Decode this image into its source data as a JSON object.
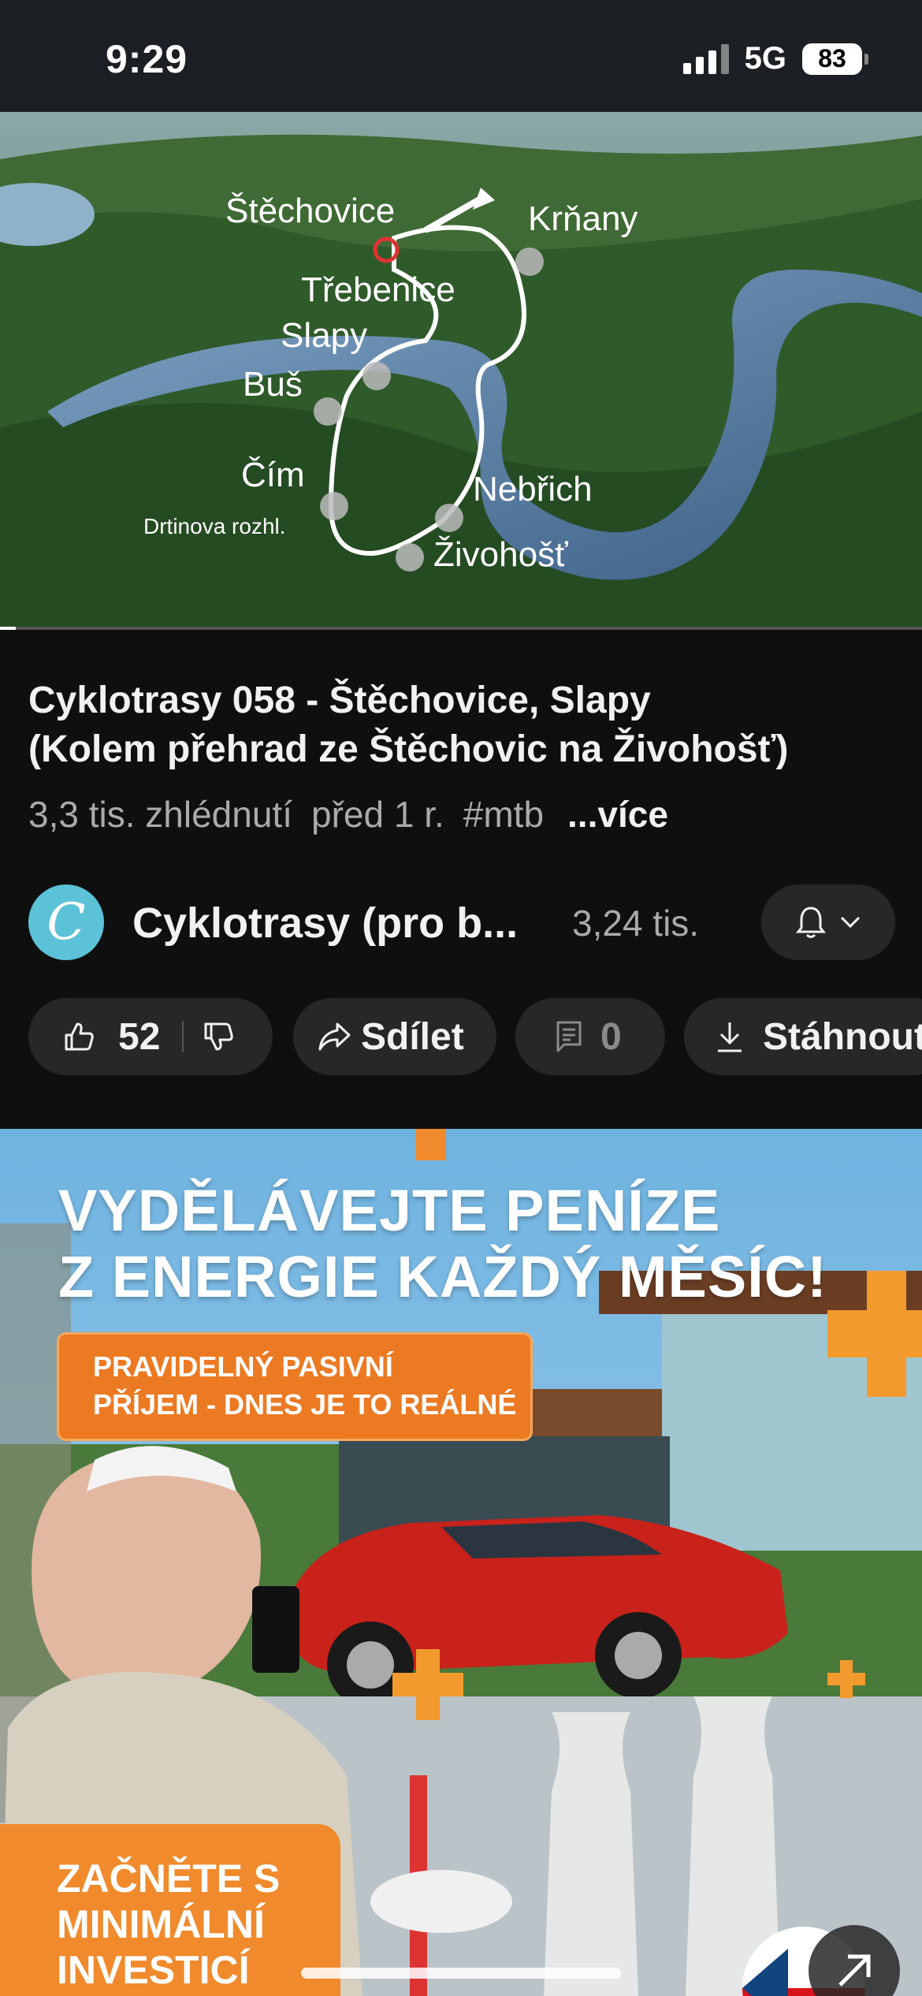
{
  "status_bar": {
    "time": "9:29",
    "network": "5G",
    "battery": "83"
  },
  "video": {
    "map_labels": [
      "Štěchovice",
      "Krňany",
      "Třebenice",
      "Slapy",
      "Buš",
      "Čím",
      "Drtinova rozhl.",
      "Nebřich",
      "Živohošť"
    ]
  },
  "info": {
    "title_line1": "Cyklotrasy 058 - Štěchovice, Slapy",
    "title_line2": "(Kolem přehrad ze Štěchovic na Živohošť)",
    "views": "3,3 tis. zhlédnutí",
    "age": "před 1 r.",
    "hashtag": "#mtb",
    "more": "...více"
  },
  "channel": {
    "avatar_letter": "C",
    "name": "Cyklotrasy (pro b...",
    "subscribers": "3,24 tis."
  },
  "actions": {
    "likes": "52",
    "share": "Sdílet",
    "comments": "0",
    "download": "Stáhnout"
  },
  "ad": {
    "headline_line1": "VYDĚLÁVEJTE PENÍZE",
    "headline_line2": "Z ENERGIE KAŽDÝ MĚSÍC!",
    "box_line1": "PRAVIDELNÝ PASIVNÍ",
    "box_line2": "PŘÍJEM - DNES JE TO REÁLNÉ",
    "cta_line1": "ZAČNĚTE S",
    "cta_line2": "MINIMÁLNÍ",
    "cta_line3": "INVESTICÍ"
  },
  "icons": [
    "signal-icon",
    "battery-icon",
    "bell-icon",
    "chevron-down-icon",
    "thumbs-up-icon",
    "thumbs-down-icon",
    "share-icon",
    "comment-icon",
    "download-icon",
    "external-link-icon"
  ],
  "colors": {
    "background": "#0f0f0f",
    "pill": "#272727",
    "avatar": "#5bc2d7",
    "ad_orange": "#ec7a23"
  }
}
